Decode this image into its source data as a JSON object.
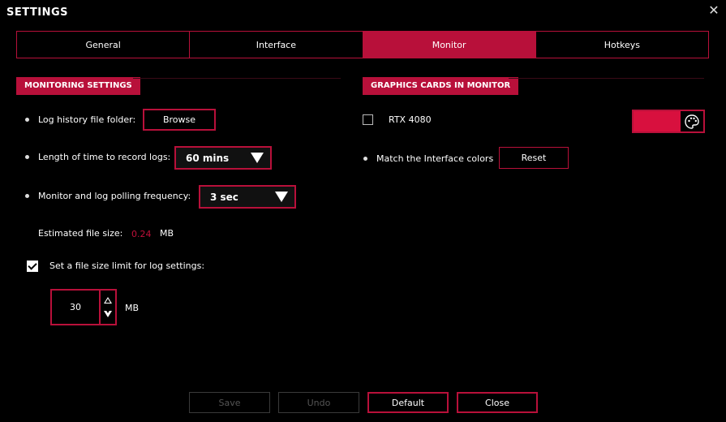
{
  "window": {
    "title": "SETTINGS",
    "close_glyph": "✕"
  },
  "tabs": [
    {
      "label": "General",
      "active": false
    },
    {
      "label": "Interface",
      "active": false
    },
    {
      "label": "Monitor",
      "active": true
    },
    {
      "label": "Hotkeys",
      "active": false
    }
  ],
  "monitoring": {
    "section_title": "MONITORING SETTINGS",
    "log_folder_label": "Log history file folder:",
    "browse_label": "Browse",
    "record_length_label": "Length of time to record logs:",
    "record_length_value": "60 mins",
    "polling_label": "Monitor and log polling frequency:",
    "polling_value": "3 sec",
    "est_size_label": "Estimated file size:",
    "est_size_value": "0.24",
    "est_size_unit": "MB",
    "limit_label": "Set a file size limit for log settings:",
    "limit_checked": true,
    "limit_value": "30",
    "limit_unit": "MB"
  },
  "graphics": {
    "section_title": "GRAPHICS CARDS IN MONITOR",
    "card_name": "RTX 4080",
    "card_checked": false,
    "card_color": "#d8103e",
    "match_label": "Match the Interface colors",
    "reset_label": "Reset"
  },
  "footer": {
    "save_label": "Save",
    "undo_label": "Undo",
    "default_label": "Default",
    "close_label": "Close"
  },
  "colors": {
    "accent": "#b8103a",
    "accent_text": "#c0103a",
    "background": "#000000"
  },
  "icons": {
    "palette": "palette-icon",
    "close": "close-icon"
  }
}
